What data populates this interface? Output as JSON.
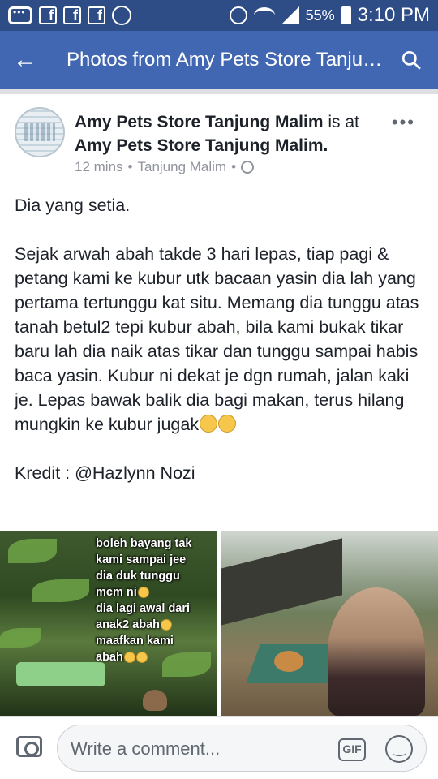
{
  "status_bar": {
    "battery_percent": "55%",
    "time": "3:10 PM",
    "icons": [
      "chat-bubble-icon",
      "facebook-icon",
      "facebook-icon",
      "facebook-icon",
      "whatsapp-icon",
      "alarm-icon",
      "wifi-icon",
      "signal-icon",
      "battery-icon"
    ]
  },
  "app_bar": {
    "title": "Photos from Amy Pets Store Tanjung Malim",
    "back_icon": "back-arrow-icon",
    "search_icon": "search-icon"
  },
  "post": {
    "author": "Amy Pets Store Tanjung Malim",
    "connector": "is at",
    "location_name": "Amy Pets Store Tanjung Malim.",
    "time_ago": "12 mins",
    "place": "Tanjung Malim",
    "more_icon": "more-options-icon",
    "privacy_icon": "globe-icon",
    "body_line1": "Dia yang setia.",
    "body_para2": "Sejak arwah abah takde 3 hari lepas, tiap pagi & petang kami ke kubur utk bacaan yasin dia lah yang pertama tertunggu kat situ. Memang dia tunggu atas tanah betul2 tepi kubur abah, bila kami bukak tikar baru lah dia naik atas tikar dan tunggu sampai habis baca yasin. Kubur ni dekat je dgn rumah, jalan kaki je. Lepas bawak balik dia bagi makan, terus hilang mungkin ke kubur jugak",
    "credit": "Kredit : @Hazlynn Nozi"
  },
  "photos": {
    "left_overlay_lines": [
      "boleh  bayang tak",
      "kami sampai jee",
      "dia duk tunggu",
      "mcm ni",
      "dia lagi awal dari",
      "anak2 abah",
      "maafkan kami",
      "abah"
    ]
  },
  "comment_bar": {
    "placeholder": "Write a comment...",
    "gif_label": "GIF"
  },
  "colors": {
    "status_bar": "#2e4c86",
    "app_bar": "#4267b2",
    "text": "#1d2129",
    "meta_text": "#90949c"
  }
}
